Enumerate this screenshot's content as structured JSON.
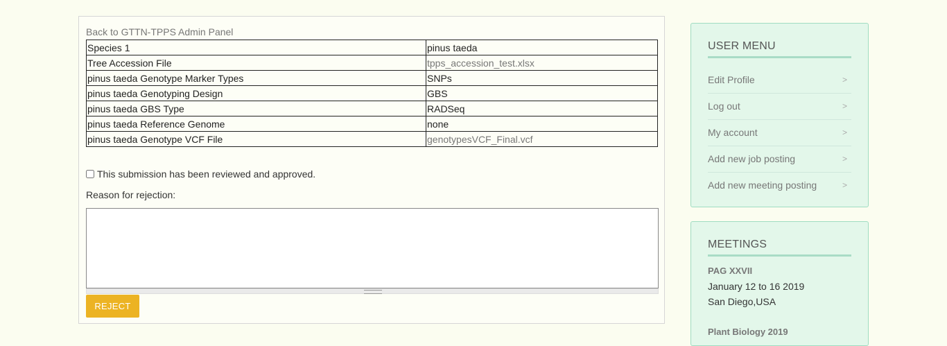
{
  "main": {
    "back_link": "Back to GTTN-TPPS Admin Panel",
    "table": [
      {
        "label": "Species 1",
        "value": "pinus taeda",
        "is_link": false
      },
      {
        "label": "Tree Accession File",
        "value": "tpps_accession_test.xlsx",
        "is_link": true
      },
      {
        "label": "pinus taeda Genotype Marker Types",
        "value": "SNPs",
        "is_link": false
      },
      {
        "label": "pinus taeda Genotyping Design",
        "value": "GBS",
        "is_link": false
      },
      {
        "label": "pinus taeda GBS Type",
        "value": "RADSeq",
        "is_link": false
      },
      {
        "label": "pinus taeda Reference Genome",
        "value": "none",
        "is_link": false
      },
      {
        "label": "pinus taeda Genotype VCF File",
        "value": "genotypesVCF_Final.vcf",
        "is_link": true
      }
    ],
    "approve_label": "This submission has been reviewed and approved.",
    "reason_label": "Reason for rejection:",
    "reason_value": "",
    "reject_button": "REJECT"
  },
  "user_menu": {
    "title": "USER MENU",
    "items": [
      "Edit Profile",
      "Log out",
      "My account",
      "Add new job posting",
      "Add new meeting posting"
    ]
  },
  "meetings": {
    "title": "MEETINGS",
    "events": [
      {
        "name": "PAG XXVII",
        "date": "January 12 to 16 2019",
        "location": "San Diego,USA"
      },
      {
        "name": "Plant Biology 2019"
      }
    ]
  },
  "colors": {
    "accent_button": "#ecb323",
    "sidebar_bg": "#e3f7ea",
    "page_bg": "#fbfdf0"
  },
  "icons": {
    "menu_chevron": "chevron-right-icon"
  }
}
